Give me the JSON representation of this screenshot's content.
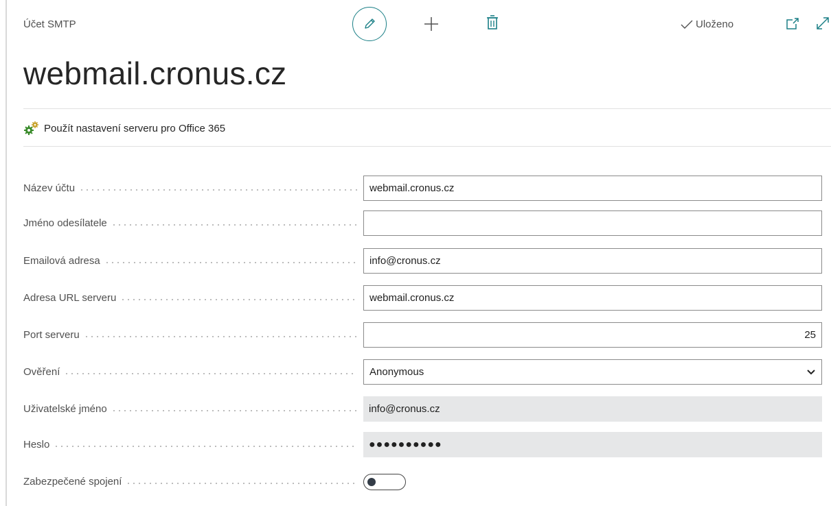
{
  "header": {
    "caption": "Účet SMTP",
    "saved_label": "Uloženo",
    "icons": {
      "edit": "pencil-icon",
      "new": "plus-icon",
      "delete": "trash-icon",
      "saved": "checkmark-icon",
      "popout": "open-in-new-window-icon",
      "expand": "expand-icon"
    }
  },
  "page": {
    "title": "webmail.cronus.cz"
  },
  "action": {
    "label": "Použít nastavení serveru pro Office 365",
    "icon": "gears-icon"
  },
  "fields": [
    {
      "label": "Název účtu",
      "value": "webmail.cronus.cz"
    },
    {
      "label": "Jméno odesílatele",
      "value": ""
    },
    {
      "label": "Emailová adresa",
      "value": "info@cronus.cz"
    },
    {
      "label": "Adresa URL serveru",
      "value": "webmail.cronus.cz"
    },
    {
      "label": "Port serveru",
      "value": "25"
    },
    {
      "label": "Ověření",
      "value": "Anonymous"
    },
    {
      "label": "Uživatelské jméno",
      "value": "info@cronus.cz"
    },
    {
      "label": "Heslo",
      "value": "●●●●●●●●●●"
    },
    {
      "label": "Zabezpečené spojení",
      "value": false
    }
  ],
  "colors": {
    "accent": "#1a7f86",
    "action_icon_green": "#3a8b2b",
    "disabled_field_bg": "#e6e7e8"
  }
}
